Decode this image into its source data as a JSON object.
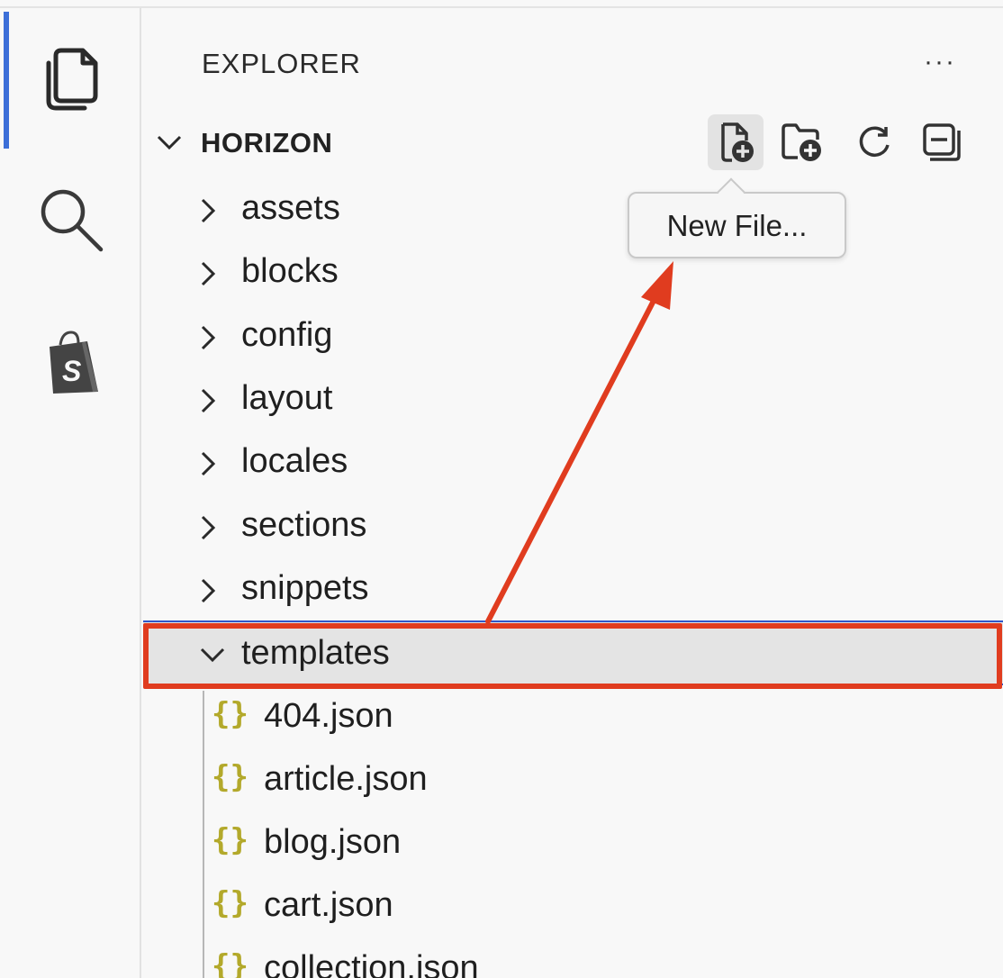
{
  "explorer": {
    "title": "EXPLORER",
    "more_label": "···",
    "section_title": "HORIZON"
  },
  "toolbar": {
    "new_file_icon": "new-file-icon",
    "new_folder_icon": "new-folder-icon",
    "refresh_icon": "refresh-icon",
    "collapse_icon": "collapse-all-icon"
  },
  "tooltip": {
    "text": "New File..."
  },
  "tree": {
    "folders": [
      "assets",
      "blocks",
      "config",
      "layout",
      "locales",
      "sections",
      "snippets"
    ],
    "open_folder": "templates",
    "files": [
      "404.json",
      "article.json",
      "blog.json",
      "cart.json",
      "collection.json"
    ],
    "file_icon_glyph": "{}"
  },
  "activity_bar": {
    "items": [
      "explorer-icon",
      "search-icon",
      "shopify-icon"
    ]
  },
  "colors": {
    "highlight": "#e03c1f",
    "selection_border": "#2f56c9",
    "active_indicator": "#3c6fd8",
    "json_icon": "#b3a92b"
  }
}
